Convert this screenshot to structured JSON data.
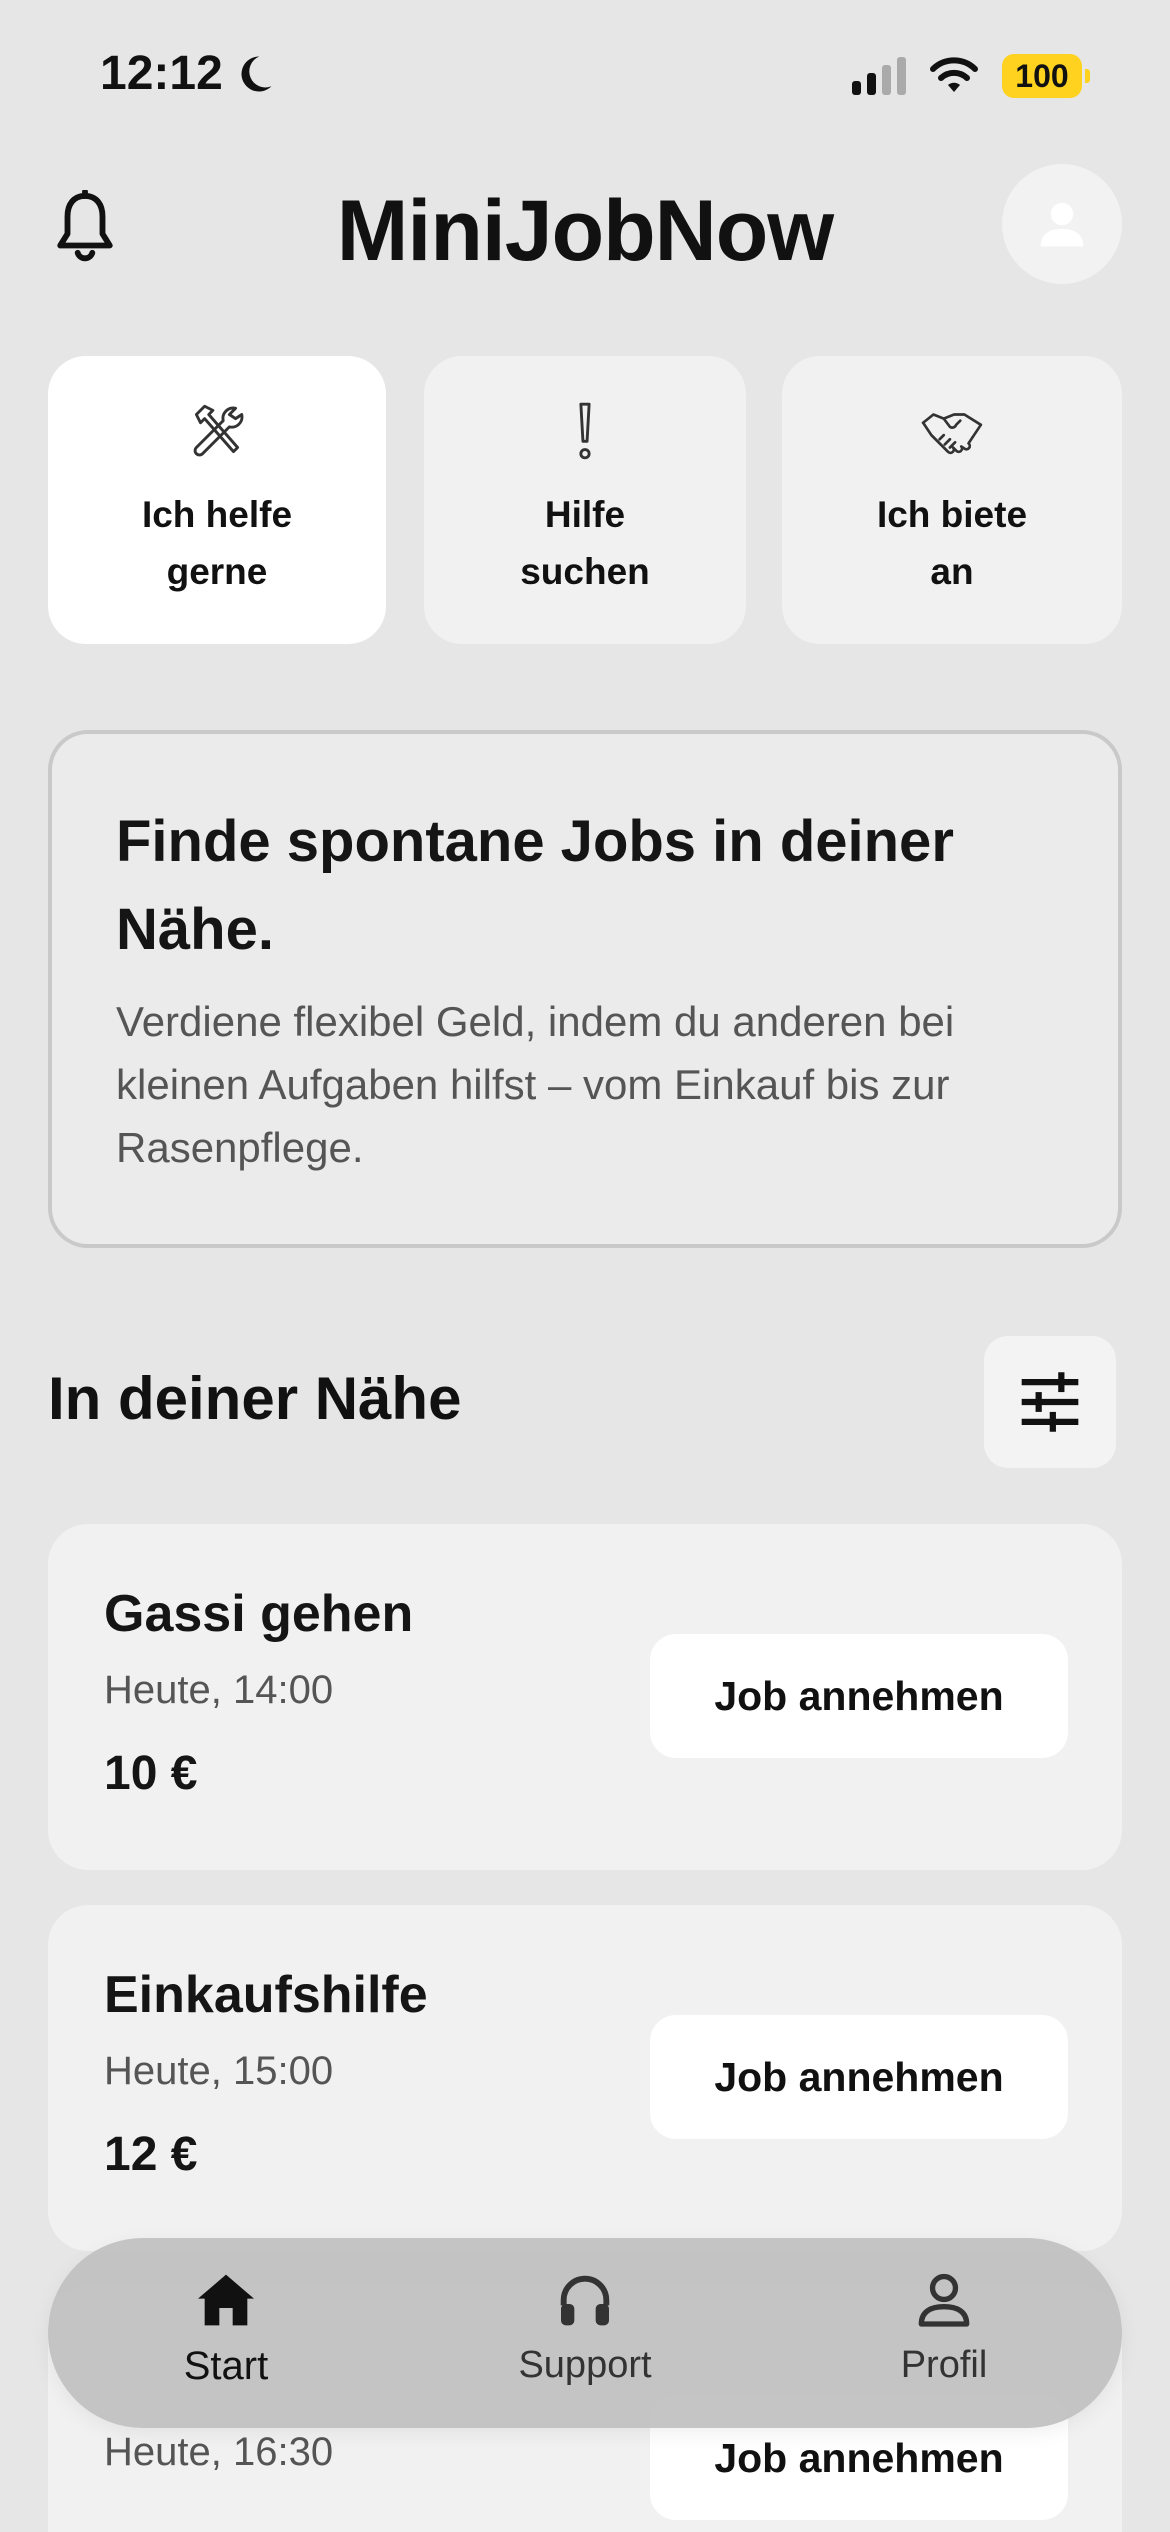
{
  "status_bar": {
    "time": "12:12",
    "battery": "100",
    "icons": [
      "moon-icon",
      "cellular-signal-icon",
      "wifi-icon",
      "battery-icon"
    ],
    "battery_color": "#ffd21f"
  },
  "header": {
    "title": "MiniJobNow",
    "icons": [
      "bell-icon",
      "profile-avatar-icon"
    ]
  },
  "roles": [
    {
      "label": "Ich helfe\ngerne",
      "icon": "hammer-wrench-icon",
      "selected": true
    },
    {
      "label": "Hilfe\nsuchen",
      "icon": "exclamation-icon",
      "selected": false
    },
    {
      "label": "Ich biete\nan",
      "icon": "handshake-icon",
      "selected": false
    }
  ],
  "intro": {
    "title": "Finde spontane Jobs in deiner Nähe.",
    "text": "Verdiene flexibel Geld, indem du anderen bei kleinen Aufgaben hilfst – vom Einkauf bis zur Rasenpflege."
  },
  "nearby": {
    "title": "In deiner Nähe",
    "filter_icon": "sliders-icon"
  },
  "jobs": [
    {
      "title": "Gassi gehen",
      "time": "Heute, 14:00",
      "pay": "10 €",
      "button": "Job annehmen"
    },
    {
      "title": "Einkaufshilfe",
      "time": "Heute, 15:00",
      "pay": "12 €",
      "button": "Job annehmen"
    },
    {
      "title": "",
      "time": "Heute, 16:30",
      "pay": "",
      "button": "Job annehmen"
    }
  ],
  "nav": {
    "items": [
      {
        "label": "Start",
        "icon": "home-icon",
        "active": true
      },
      {
        "label": "Support",
        "icon": "headphones-icon",
        "active": false
      },
      {
        "label": "Profil",
        "icon": "person-icon",
        "active": false
      }
    ]
  }
}
